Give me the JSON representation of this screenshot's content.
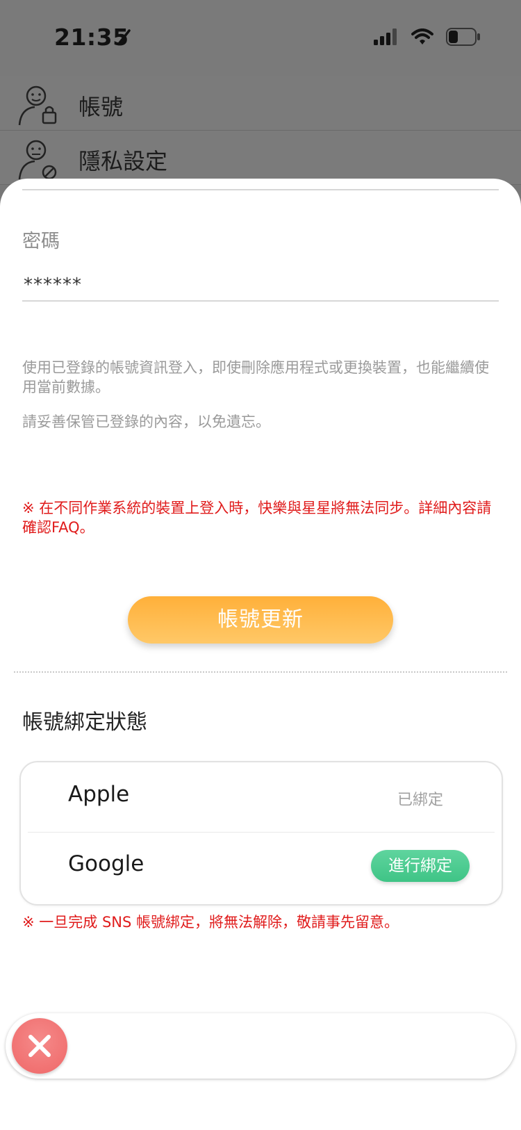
{
  "status_bar": {
    "time": "21:35"
  },
  "background_menu": {
    "items": [
      {
        "label": "帳號",
        "icon": "user-lock-icon"
      },
      {
        "label": "隱私設定",
        "icon": "user-privacy-icon"
      }
    ]
  },
  "account_form": {
    "password_label": "密碼",
    "password_value": "******"
  },
  "info": {
    "paragraph1": "使用已登錄的帳號資訊登入，即使刪除應用程式或更換裝置，也能繼續使用當前數據。",
    "paragraph2": "請妥善保管已登錄的內容，以免遺忘。"
  },
  "warning_sync": "※ 在不同作業系統的裝置上登入時，快樂與星星將無法同步。詳細內容請確認FAQ。",
  "update_button_label": "帳號更新",
  "binding": {
    "title": "帳號綁定狀態",
    "providers": [
      {
        "name": "Apple",
        "status": "已綁定"
      },
      {
        "name": "Google",
        "action": "進行綁定"
      }
    ]
  },
  "warning_sns": "※ 一旦完成 SNS 帳號綁定，將無法解除，敬請事先留意。",
  "colors": {
    "accent_orange": "#ffb03a",
    "accent_green": "#4fcc92",
    "warning_red": "#e01b1b",
    "close_red": "#ef6767"
  }
}
